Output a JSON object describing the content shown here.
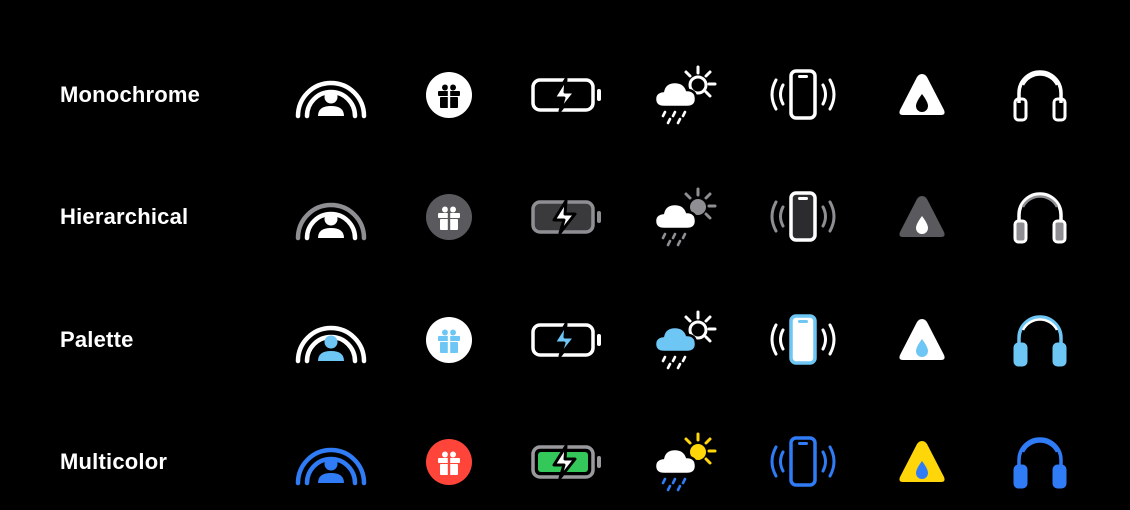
{
  "rows": [
    {
      "label": "Monochrome"
    },
    {
      "label": "Hierarchical"
    },
    {
      "label": "Palette"
    },
    {
      "label": "Multicolor"
    }
  ],
  "icons": [
    "person-badge-icon",
    "gift-circle-icon",
    "battery-charging-icon",
    "cloud-sun-rain-icon",
    "phone-vibrate-icon",
    "drop-triangle-icon",
    "headphones-icon"
  ],
  "colors": {
    "background": "#000000",
    "white": "#ffffff",
    "hierarchical_gray": "#8e8e93",
    "palette_blue": "#6ec6f5",
    "multicolor_blue": "#2f7cf6",
    "multicolor_red": "#ff453a",
    "multicolor_green": "#34c759",
    "multicolor_yellow": "#ffd60a",
    "multicolor_gray": "#9a9a9e"
  }
}
